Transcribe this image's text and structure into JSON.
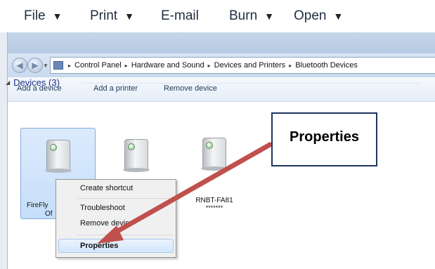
{
  "menu": {
    "items": [
      {
        "label": "File",
        "has_arrow": true
      },
      {
        "label": "Print",
        "has_arrow": true
      },
      {
        "label": "E-mail",
        "has_arrow": false
      },
      {
        "label": "Burn",
        "has_arrow": true
      },
      {
        "label": "Open",
        "has_arrow": true
      }
    ],
    "arrow_glyph": "▼"
  },
  "address": {
    "breadcrumbs": [
      "Control Panel",
      "Hardware and Sound",
      "Devices and Printers",
      "Bluetooth Devices"
    ],
    "separator": "▸"
  },
  "toolbar": {
    "add_device": "Add a device",
    "add_printer": "Add a printer",
    "remove_device": "Remove device"
  },
  "devices_group": {
    "header": "Devices (3)",
    "items": [
      {
        "name_line1": "FireFly",
        "name_line2": "Of",
        "selected": true
      },
      {
        "name_line1": "",
        "name_line2": "",
        "selected": false
      },
      {
        "name_line1": "RNBT-FA81",
        "name_line2": "*******",
        "selected": false
      }
    ]
  },
  "context_menu": {
    "create_shortcut": "Create shortcut",
    "troubleshoot": "Troubleshoot",
    "remove_device": "Remove device",
    "properties": "Properties"
  },
  "callout": {
    "text": "Properties",
    "border_color": "#1e3660"
  },
  "arrow_color": "#c0504d"
}
